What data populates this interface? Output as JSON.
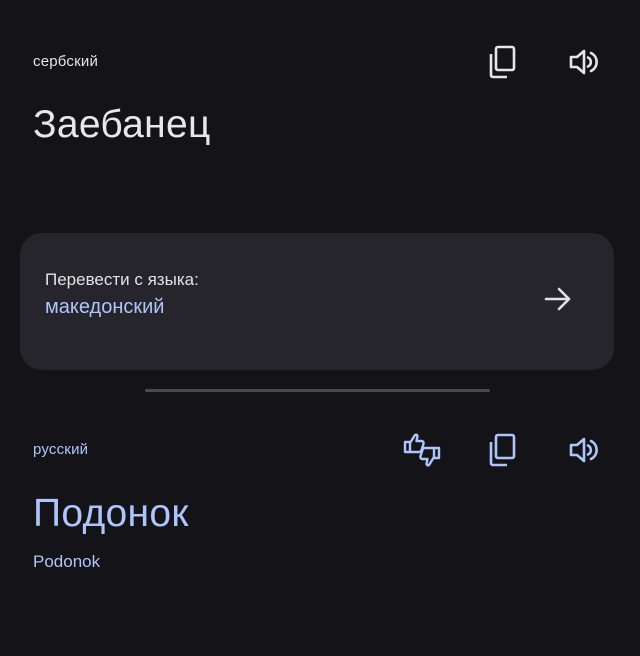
{
  "source": {
    "language": "сербский",
    "text": "Заебанец"
  },
  "detect_card": {
    "label": "Перевести с языка:",
    "value": "македонский"
  },
  "target": {
    "language": "русский",
    "text": "Подонок",
    "transliteration": "Podonok"
  },
  "icons": {
    "copy": "copy-icon",
    "speaker": "speaker-icon",
    "feedback": "thumbs-feedback-icon",
    "arrow": "arrow-right-icon"
  },
  "colors": {
    "background": "#141418",
    "card": "#25252b",
    "accent": "#aec5fb",
    "text": "#e8e8ec"
  }
}
